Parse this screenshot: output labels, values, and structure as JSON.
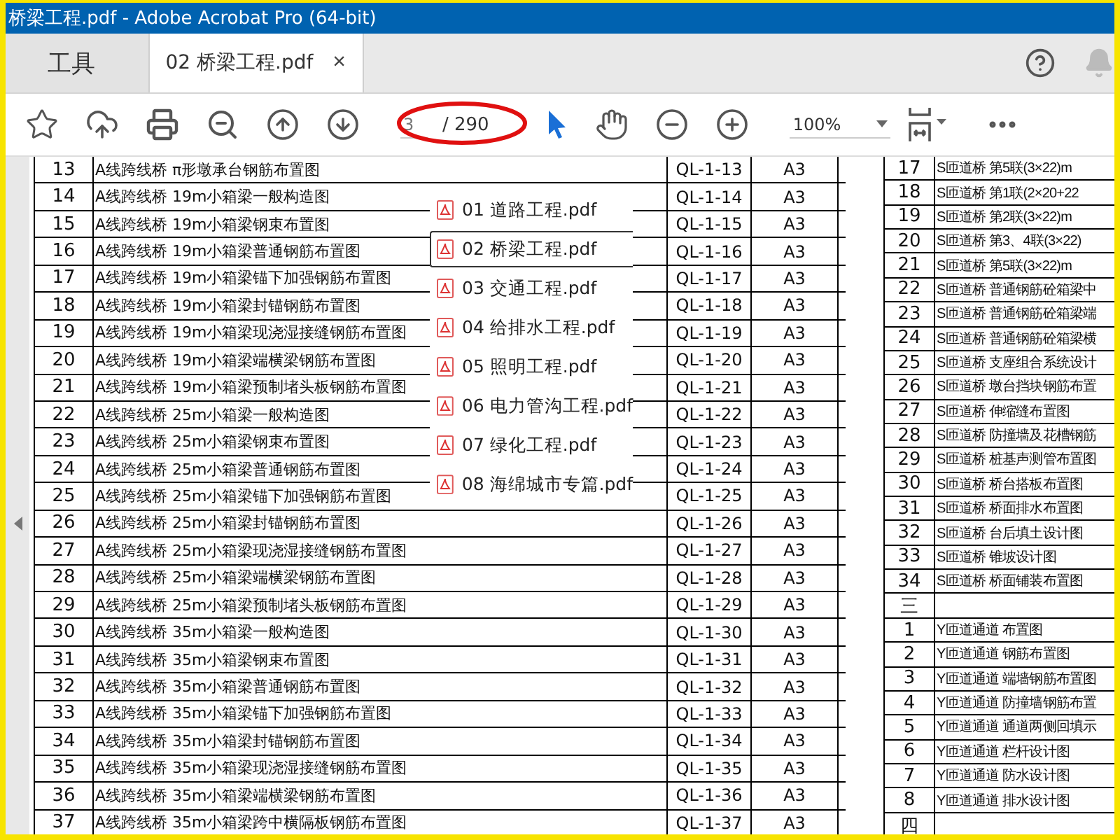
{
  "window": {
    "title": "桥梁工程.pdf - Adobe Acrobat Pro (64-bit)"
  },
  "tabs": [
    {
      "label": "工具",
      "selected": false,
      "closable": false
    },
    {
      "label": "02 桥梁工程.pdf",
      "selected": true,
      "closable": true
    }
  ],
  "tab_close": "×",
  "toolbar": {
    "page_field": {
      "value": "3"
    },
    "page_total": "/ 290",
    "zoom": {
      "value": "100%"
    }
  },
  "file_menu": [
    {
      "label": "01 道路工程.pdf",
      "selected": false
    },
    {
      "label": "02 桥梁工程.pdf",
      "selected": true
    },
    {
      "label": "03 交通工程.pdf",
      "selected": false
    },
    {
      "label": "04 给排水工程.pdf",
      "selected": false
    },
    {
      "label": "05 照明工程.pdf",
      "selected": false
    },
    {
      "label": "06 电力管沟工程.pdf",
      "selected": false
    },
    {
      "label": "07 绿化工程.pdf",
      "selected": false
    },
    {
      "label": "08 海绵城市专篇.pdf",
      "selected": false
    }
  ],
  "left_page": {
    "rows": [
      {
        "no": "13",
        "name": "A线跨线桥 π形墩承台钢筋布置图",
        "code": "QL-1-13",
        "size": "A3"
      },
      {
        "no": "14",
        "name": "A线跨线桥 19m小箱梁一般构造图",
        "code": "QL-1-14",
        "size": "A3"
      },
      {
        "no": "15",
        "name": "A线跨线桥 19m小箱梁钢束布置图",
        "code": "QL-1-15",
        "size": "A3"
      },
      {
        "no": "16",
        "name": "A线跨线桥 19m小箱梁普通钢筋布置图",
        "code": "QL-1-16",
        "size": "A3"
      },
      {
        "no": "17",
        "name": "A线跨线桥 19m小箱梁锚下加强钢筋布置图",
        "code": "QL-1-17",
        "size": "A3"
      },
      {
        "no": "18",
        "name": "A线跨线桥 19m小箱梁封锚钢筋布置图",
        "code": "QL-1-18",
        "size": "A3"
      },
      {
        "no": "19",
        "name": "A线跨线桥 19m小箱梁现浇湿接缝钢筋布置图",
        "code": "QL-1-19",
        "size": "A3"
      },
      {
        "no": "20",
        "name": "A线跨线桥 19m小箱梁端横梁钢筋布置图",
        "code": "QL-1-20",
        "size": "A3"
      },
      {
        "no": "21",
        "name": "A线跨线桥 19m小箱梁预制堵头板钢筋布置图",
        "code": "QL-1-21",
        "size": "A3"
      },
      {
        "no": "22",
        "name": "A线跨线桥 25m小箱梁一般构造图",
        "code": "QL-1-22",
        "size": "A3"
      },
      {
        "no": "23",
        "name": "A线跨线桥 25m小箱梁钢束布置图",
        "code": "QL-1-23",
        "size": "A3"
      },
      {
        "no": "24",
        "name": "A线跨线桥 25m小箱梁普通钢筋布置图",
        "code": "QL-1-24",
        "size": "A3"
      },
      {
        "no": "25",
        "name": "A线跨线桥 25m小箱梁锚下加强钢筋布置图",
        "code": "QL-1-25",
        "size": "A3"
      },
      {
        "no": "26",
        "name": "A线跨线桥 25m小箱梁封锚钢筋布置图",
        "code": "QL-1-26",
        "size": "A3"
      },
      {
        "no": "27",
        "name": "A线跨线桥 25m小箱梁现浇湿接缝钢筋布置图",
        "code": "QL-1-27",
        "size": "A3"
      },
      {
        "no": "28",
        "name": "A线跨线桥 25m小箱梁端横梁钢筋布置图",
        "code": "QL-1-28",
        "size": "A3"
      },
      {
        "no": "29",
        "name": "A线跨线桥 25m小箱梁预制堵头板钢筋布置图",
        "code": "QL-1-29",
        "size": "A3"
      },
      {
        "no": "30",
        "name": "A线跨线桥 35m小箱梁一般构造图",
        "code": "QL-1-30",
        "size": "A3"
      },
      {
        "no": "31",
        "name": "A线跨线桥 35m小箱梁钢束布置图",
        "code": "QL-1-31",
        "size": "A3"
      },
      {
        "no": "32",
        "name": "A线跨线桥 35m小箱梁普通钢筋布置图",
        "code": "QL-1-32",
        "size": "A3"
      },
      {
        "no": "33",
        "name": "A线跨线桥 35m小箱梁锚下加强钢筋布置图",
        "code": "QL-1-33",
        "size": "A3"
      },
      {
        "no": "34",
        "name": "A线跨线桥 35m小箱梁封锚钢筋布置图",
        "code": "QL-1-34",
        "size": "A3"
      },
      {
        "no": "35",
        "name": "A线跨线桥 35m小箱梁现浇湿接缝钢筋布置图",
        "code": "QL-1-35",
        "size": "A3"
      },
      {
        "no": "36",
        "name": "A线跨线桥 35m小箱梁端横梁钢筋布置图",
        "code": "QL-1-36",
        "size": "A3"
      },
      {
        "no": "37",
        "name": "A线跨线桥 35m小箱梁跨中横隔板钢筋布置图",
        "code": "QL-1-37",
        "size": "A3"
      }
    ]
  },
  "right_page": {
    "rows": [
      {
        "no": "17",
        "name": "S匝道桥 第5联(3×22)m"
      },
      {
        "no": "18",
        "name": "S匝道桥 第1联(2×20+22"
      },
      {
        "no": "19",
        "name": "S匝道桥 第2联(3×22)m"
      },
      {
        "no": "20",
        "name": "S匝道桥 第3、4联(3×22)"
      },
      {
        "no": "21",
        "name": "S匝道桥 第5联(3×22)m"
      },
      {
        "no": "22",
        "name": "S匝道桥 普通钢筋砼箱梁中"
      },
      {
        "no": "23",
        "name": "S匝道桥 普通钢筋砼箱梁端"
      },
      {
        "no": "24",
        "name": "S匝道桥 普通钢筋砼箱梁横"
      },
      {
        "no": "25",
        "name": "S匝道桥 支座组合系统设计"
      },
      {
        "no": "26",
        "name": "S匝道桥 墩台挡块钢筋布置"
      },
      {
        "no": "27",
        "name": "S匝道桥 伸缩缝布置图"
      },
      {
        "no": "28",
        "name": "S匝道桥 防撞墙及花槽钢筋"
      },
      {
        "no": "29",
        "name": "S匝道桥 桩基声测管布置图"
      },
      {
        "no": "30",
        "name": "S匝道桥 桥台搭板布置图"
      },
      {
        "no": "31",
        "name": "S匝道桥 桥面排水布置图"
      },
      {
        "no": "32",
        "name": "S匝道桥 台后填土设计图"
      },
      {
        "no": "33",
        "name": "S匝道桥 锥坡设计图"
      },
      {
        "no": "34",
        "name": "S匝道桥 桥面铺装布置图"
      },
      {
        "no": "三"
      },
      {
        "no": "1",
        "name": "Y匝道通道 布置图"
      },
      {
        "no": "2",
        "name": "Y匝道通道 钢筋布置图"
      },
      {
        "no": "3",
        "name": "Y匝道通道 端墙钢筋布置图"
      },
      {
        "no": "4",
        "name": "Y匝道通道 防撞墙钢筋布置"
      },
      {
        "no": "5",
        "name": "Y匝道通道 通道两侧回填示"
      },
      {
        "no": "6",
        "name": "Y匝道通道 栏杆设计图"
      },
      {
        "no": "7",
        "name": "Y匝道通道 防水设计图"
      },
      {
        "no": "8",
        "name": "Y匝道通道 排水设计图"
      },
      {
        "no": "四"
      }
    ]
  }
}
